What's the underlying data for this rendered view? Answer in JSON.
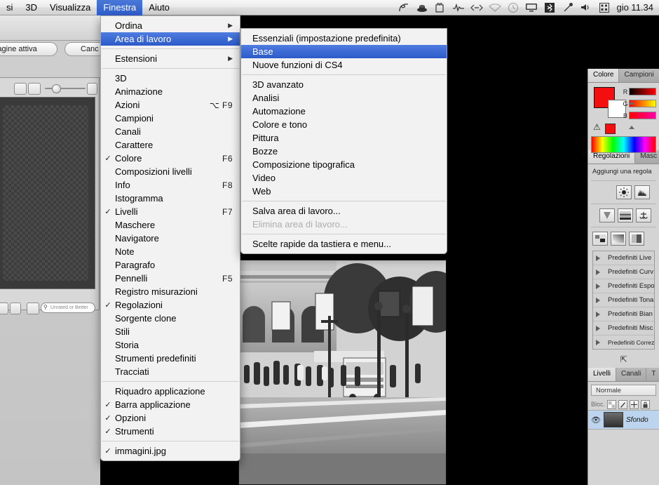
{
  "menubar": {
    "items": [
      {
        "label": "si",
        "active": false
      },
      {
        "label": "3D",
        "active": false
      },
      {
        "label": "Visualizza",
        "active": false
      },
      {
        "label": "Finestra",
        "active": true
      },
      {
        "label": "Aiuto",
        "active": false
      }
    ],
    "status_icons": [
      {
        "name": "script-icon",
        "dim": false
      },
      {
        "name": "ink-well-icon",
        "dim": false
      },
      {
        "name": "castle-icon",
        "dim": false
      },
      {
        "name": "activity-icon",
        "dim": false
      },
      {
        "name": "code-brackets-icon",
        "dim": false
      },
      {
        "name": "wifi-icon",
        "dim": true
      },
      {
        "name": "time-machine-icon",
        "dim": true
      },
      {
        "name": "display-icon",
        "dim": false
      },
      {
        "name": "bluetooth-icon",
        "dim": false
      },
      {
        "name": "eyedropper-icon",
        "dim": false
      },
      {
        "name": "volume-icon",
        "dim": false
      },
      {
        "name": "spotlight-grid-icon",
        "dim": false
      }
    ],
    "clock": "gio 11.34"
  },
  "menu_finestra": {
    "title": "Finestra",
    "groups": [
      [
        {
          "label": "Ordina",
          "checked": false,
          "shortcut": "",
          "submenu": true,
          "selected": false,
          "disabled": false
        },
        {
          "label": "Area di lavoro",
          "checked": false,
          "shortcut": "",
          "submenu": true,
          "selected": true,
          "disabled": false
        }
      ],
      [
        {
          "label": "Estensioni",
          "checked": false,
          "shortcut": "",
          "submenu": true,
          "selected": false,
          "disabled": false
        }
      ],
      [
        {
          "label": "3D",
          "checked": false,
          "shortcut": "",
          "submenu": false,
          "selected": false,
          "disabled": false
        },
        {
          "label": "Animazione",
          "checked": false,
          "shortcut": "",
          "submenu": false,
          "selected": false,
          "disabled": false
        },
        {
          "label": "Azioni",
          "checked": false,
          "shortcut": "⌥ F9",
          "submenu": false,
          "selected": false,
          "disabled": false
        },
        {
          "label": "Campioni",
          "checked": false,
          "shortcut": "",
          "submenu": false,
          "selected": false,
          "disabled": false
        },
        {
          "label": "Canali",
          "checked": false,
          "shortcut": "",
          "submenu": false,
          "selected": false,
          "disabled": false
        },
        {
          "label": "Carattere",
          "checked": false,
          "shortcut": "",
          "submenu": false,
          "selected": false,
          "disabled": false
        },
        {
          "label": "Colore",
          "checked": true,
          "shortcut": "F6",
          "submenu": false,
          "selected": false,
          "disabled": false
        },
        {
          "label": "Composizioni livelli",
          "checked": false,
          "shortcut": "",
          "submenu": false,
          "selected": false,
          "disabled": false
        },
        {
          "label": "Info",
          "checked": false,
          "shortcut": "F8",
          "submenu": false,
          "selected": false,
          "disabled": false
        },
        {
          "label": "Istogramma",
          "checked": false,
          "shortcut": "",
          "submenu": false,
          "selected": false,
          "disabled": false
        },
        {
          "label": "Livelli",
          "checked": true,
          "shortcut": "F7",
          "submenu": false,
          "selected": false,
          "disabled": false
        },
        {
          "label": "Maschere",
          "checked": false,
          "shortcut": "",
          "submenu": false,
          "selected": false,
          "disabled": false
        },
        {
          "label": "Navigatore",
          "checked": false,
          "shortcut": "",
          "submenu": false,
          "selected": false,
          "disabled": false
        },
        {
          "label": "Note",
          "checked": false,
          "shortcut": "",
          "submenu": false,
          "selected": false,
          "disabled": false
        },
        {
          "label": "Paragrafo",
          "checked": false,
          "shortcut": "",
          "submenu": false,
          "selected": false,
          "disabled": false
        },
        {
          "label": "Pennelli",
          "checked": false,
          "shortcut": "F5",
          "submenu": false,
          "selected": false,
          "disabled": false
        },
        {
          "label": "Registro misurazioni",
          "checked": false,
          "shortcut": "",
          "submenu": false,
          "selected": false,
          "disabled": false
        },
        {
          "label": "Regolazioni",
          "checked": true,
          "shortcut": "",
          "submenu": false,
          "selected": false,
          "disabled": false
        },
        {
          "label": "Sorgente clone",
          "checked": false,
          "shortcut": "",
          "submenu": false,
          "selected": false,
          "disabled": false
        },
        {
          "label": "Stili",
          "checked": false,
          "shortcut": "",
          "submenu": false,
          "selected": false,
          "disabled": false
        },
        {
          "label": "Storia",
          "checked": false,
          "shortcut": "",
          "submenu": false,
          "selected": false,
          "disabled": false
        },
        {
          "label": "Strumenti predefiniti",
          "checked": false,
          "shortcut": "",
          "submenu": false,
          "selected": false,
          "disabled": false
        },
        {
          "label": "Tracciati",
          "checked": false,
          "shortcut": "",
          "submenu": false,
          "selected": false,
          "disabled": false
        }
      ],
      [
        {
          "label": "Riquadro applicazione",
          "checked": false,
          "shortcut": "",
          "submenu": false,
          "selected": false,
          "disabled": false
        },
        {
          "label": "Barra applicazione",
          "checked": true,
          "shortcut": "",
          "submenu": false,
          "selected": false,
          "disabled": false
        },
        {
          "label": "Opzioni",
          "checked": true,
          "shortcut": "",
          "submenu": false,
          "selected": false,
          "disabled": false
        },
        {
          "label": "Strumenti",
          "checked": true,
          "shortcut": "",
          "submenu": false,
          "selected": false,
          "disabled": false
        }
      ],
      [
        {
          "label": "immagini.jpg",
          "checked": true,
          "shortcut": "",
          "submenu": false,
          "selected": false,
          "disabled": false
        }
      ]
    ]
  },
  "menu_area_di_lavoro": {
    "title": "Area di lavoro",
    "groups": [
      [
        {
          "label": "Essenziali (impostazione predefinita)",
          "selected": false,
          "disabled": false
        },
        {
          "label": "Base",
          "selected": true,
          "disabled": false
        },
        {
          "label": "Nuove funzioni di CS4",
          "selected": false,
          "disabled": false
        }
      ],
      [
        {
          "label": "3D avanzato",
          "selected": false,
          "disabled": false
        },
        {
          "label": "Analisi",
          "selected": false,
          "disabled": false
        },
        {
          "label": "Automazione",
          "selected": false,
          "disabled": false
        },
        {
          "label": "Colore e tono",
          "selected": false,
          "disabled": false
        },
        {
          "label": "Pittura",
          "selected": false,
          "disabled": false
        },
        {
          "label": "Bozze",
          "selected": false,
          "disabled": false
        },
        {
          "label": "Composizione tipografica",
          "selected": false,
          "disabled": false
        },
        {
          "label": "Video",
          "selected": false,
          "disabled": false
        },
        {
          "label": "Web",
          "selected": false,
          "disabled": false
        }
      ],
      [
        {
          "label": "Salva area di lavoro...",
          "selected": false,
          "disabled": false
        },
        {
          "label": "Elimina area di lavoro...",
          "selected": false,
          "disabled": true
        }
      ],
      [
        {
          "label": "Scelte rapide da tastiera e menu...",
          "selected": false,
          "disabled": false
        }
      ]
    ]
  },
  "background_dialog": {
    "active_image_label": "magine attiva",
    "cancel_label": "Canc",
    "rating_filter_placeholder": "Unrated or Better"
  },
  "color_panel": {
    "tabs": [
      {
        "label": "Colore",
        "active": true
      },
      {
        "label": "Campioni",
        "active": false
      }
    ],
    "foreground_color": "#f30f0f",
    "background_color": "#ffffff",
    "channels": [
      {
        "label": "R",
        "ramp": "r"
      },
      {
        "label": "G",
        "ramp": "g"
      },
      {
        "label": "B",
        "ramp": "b"
      }
    ],
    "warning_icon": "gamut-warning-icon",
    "warning_swatch": "#f30f0f"
  },
  "adjustments_panel": {
    "tabs": [
      {
        "label": "Regolazioni",
        "active": true
      },
      {
        "label": "Masc",
        "active": false
      }
    ],
    "hint": "Aggiungi una regola",
    "icon_rows": [
      [
        "brightness-contrast-icon",
        "levels-icon"
      ],
      [
        "curves-icon",
        "exposure-icon",
        "vibrance-icon"
      ],
      [
        "hue-saturation-icon",
        "gradient-map-icon",
        "color-balance-icon"
      ]
    ],
    "presets": [
      "Predefiniti Live",
      "Predefiniti Curv",
      "Predefiniti Espo",
      "Predefiniti Tona",
      "Predefiniti Bian",
      "Predefiniti Misc",
      "Predefiniti Correzi"
    ],
    "footer_icon": "return-arrow-icon"
  },
  "layers_panel": {
    "tabs": [
      {
        "label": "Livelli",
        "active": true
      },
      {
        "label": "Canali",
        "active": false
      },
      {
        "label": "T",
        "active": false
      }
    ],
    "blend_mode": "Normale",
    "lock_label": "Bloc.",
    "lock_buttons": [
      "lock-transparency-icon",
      "lock-image-icon",
      "lock-position-icon",
      "lock-all-icon"
    ],
    "layers": [
      {
        "name": "Sfondo",
        "visible": true,
        "selected": true,
        "visibility_icon": "eye-icon"
      }
    ]
  }
}
